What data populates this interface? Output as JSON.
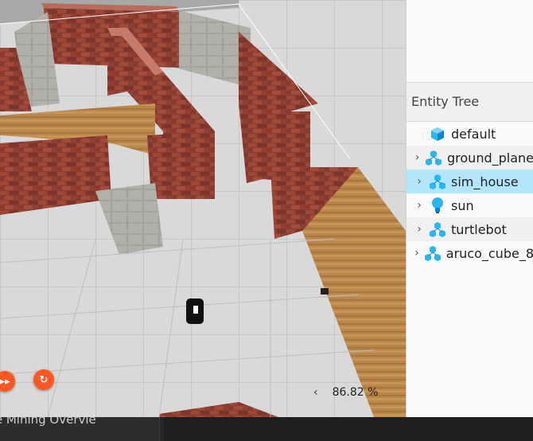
{
  "viewport": {
    "rtf_value": "86.82 %",
    "rtf_chevron": "‹",
    "fast_forward_glyph": "▸▸",
    "step_glyph": "↻"
  },
  "entity_tree": {
    "title": "Entity Tree",
    "items": [
      {
        "label": "default",
        "icon": "model-icon",
        "expandable": false
      },
      {
        "label": "ground_plane",
        "icon": "model-links-icon",
        "expandable": true
      },
      {
        "label": "sim_house",
        "icon": "model-links-icon",
        "expandable": true,
        "selected": true
      },
      {
        "label": "sun",
        "icon": "light-bulb-icon",
        "expandable": true
      },
      {
        "label": "turtlebot",
        "icon": "model-links-icon",
        "expandable": true
      },
      {
        "label": "aruco_cube_8",
        "icon": "model-links-icon",
        "expandable": true
      }
    ]
  },
  "taskbar": {
    "tab_label": "re Mining Overvie"
  },
  "colors": {
    "accent": "#ff5722",
    "selection": "#b3e5fc",
    "icon_blue": "#29b6f6"
  }
}
